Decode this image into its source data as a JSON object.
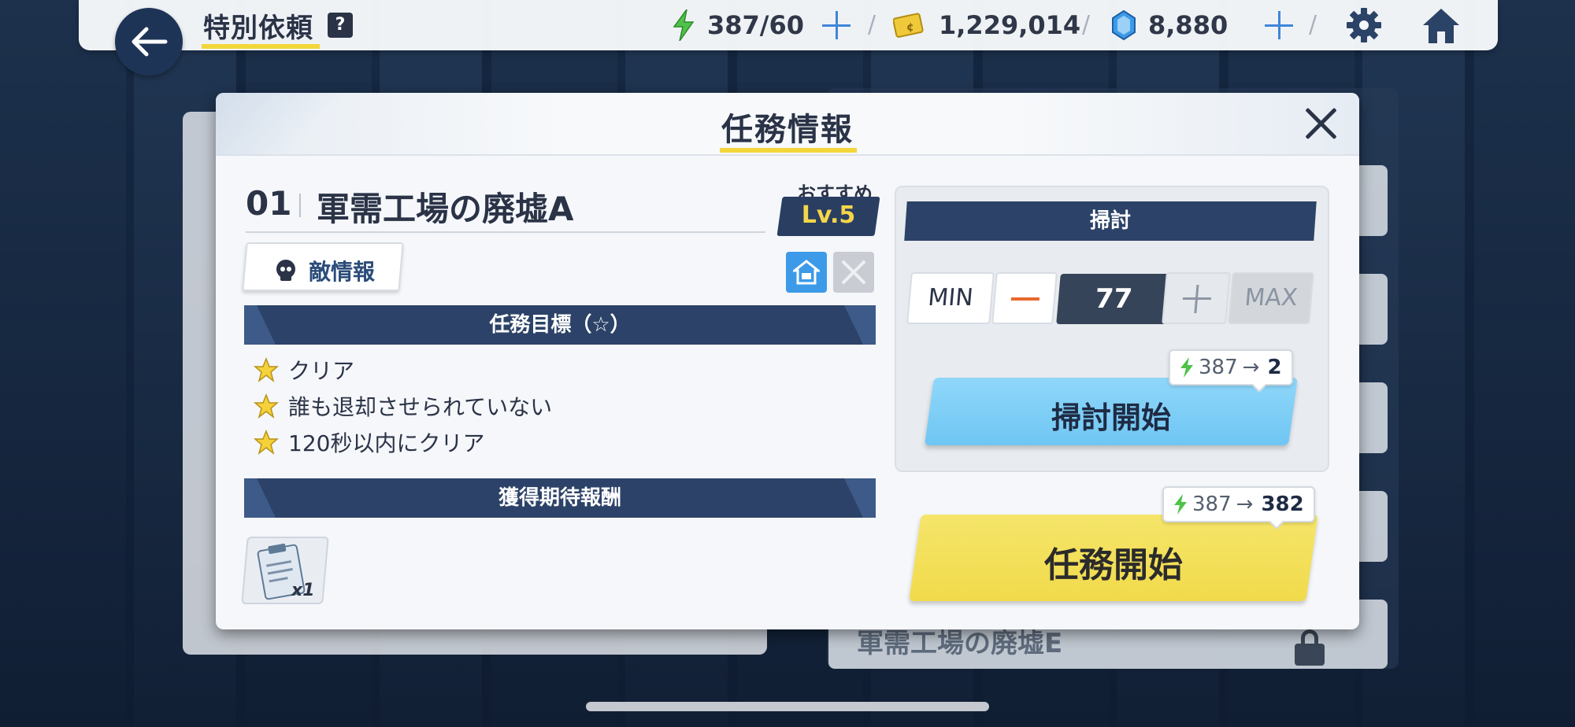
{
  "topbar": {
    "title": "特別依頼",
    "help_glyph": "?",
    "ap": "387/60",
    "credits": "1,229,014",
    "gems": "8,880"
  },
  "background": {
    "row_name": "軍需工場の廃墟E"
  },
  "modal": {
    "title": "任務情報",
    "stage_number": "01",
    "stage_name": "軍需工場の廃墟A",
    "recommended_label": "おすすめ",
    "recommended_level": "Lv.5",
    "enemy_info_label": "敵情報",
    "objectives_header": "任務目標（☆）",
    "objectives": [
      "クリア",
      "誰も退却させられていない",
      "120秒以内にクリア"
    ],
    "rewards_header": "獲得期待報酬",
    "reward_qty": "x1"
  },
  "sweep": {
    "header": "掃討",
    "min_label": "MIN",
    "max_label": "MAX",
    "count": "77",
    "ap_from": "387",
    "ap_to": "2",
    "button_label": "掃討開始"
  },
  "start": {
    "ap_from": "387",
    "ap_to": "382",
    "button_label": "任務開始"
  },
  "colors": {
    "accent_yellow": "#f3d63a",
    "navy": "#2c4268",
    "sweep_blue": "#7fcff7",
    "start_yellow": "#f3e05a",
    "energy_green": "#4fc24a"
  }
}
